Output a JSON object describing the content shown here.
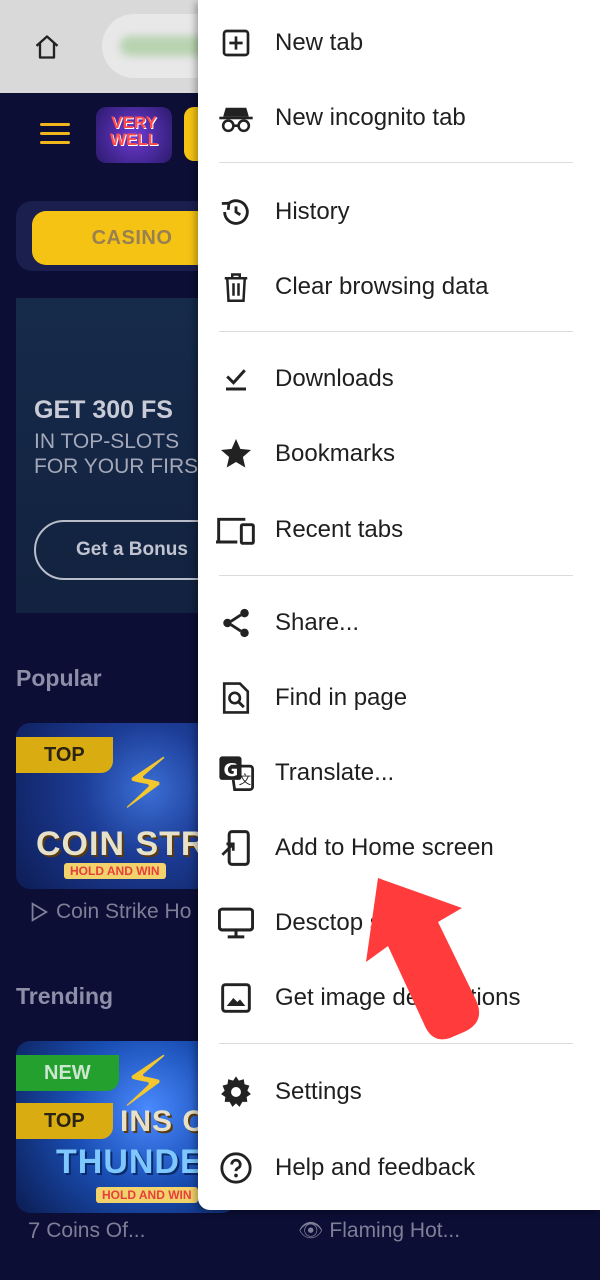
{
  "background_page": {
    "site": {
      "logo_line1": "VERY",
      "logo_line2": "WELL",
      "casino_tab": "CASINO",
      "banner": {
        "title": "GET 300 FS",
        "subtitle_line1": "IN TOP-SLOTS",
        "subtitle_line2": "FOR YOUR FIRS",
        "cta": "Get a Bonus"
      },
      "popular": {
        "title": "Popular",
        "card": {
          "tag": "TOP",
          "art_title": "COIN STRI",
          "art_sub": "HOLD AND WIN"
        },
        "game_name": "Coin Strike Ho"
      },
      "trending": {
        "title": "Trending",
        "card": {
          "tag_new": "NEW",
          "tag_top": "TOP",
          "art_title": "INS OF",
          "art_title2": "THUNDE",
          "art_sub": "HOLD AND WIN"
        },
        "game_names": [
          "Coins Of...",
          "Flaming Hot..."
        ]
      }
    }
  },
  "menu": {
    "items": [
      {
        "label": "New tab",
        "icon": "plus-box-icon"
      },
      {
        "label": "New incognito tab",
        "icon": "incognito-icon"
      },
      {
        "label": "History",
        "icon": "history-icon"
      },
      {
        "label": "Clear browsing data",
        "icon": "trash-icon"
      },
      {
        "label": "Downloads",
        "icon": "download-check-icon"
      },
      {
        "label": "Bookmarks",
        "icon": "star-icon"
      },
      {
        "label": "Recent tabs",
        "icon": "devices-icon"
      },
      {
        "label": "Share...",
        "icon": "share-icon"
      },
      {
        "label": "Find in page",
        "icon": "find-in-page-icon"
      },
      {
        "label": "Translate...",
        "icon": "translate-icon"
      },
      {
        "label": "Add to Home screen",
        "icon": "add-to-home-icon"
      },
      {
        "label": "Desctop site",
        "icon": "monitor-icon"
      },
      {
        "label": "Get image descriptions",
        "icon": "image-icon"
      },
      {
        "label": "Settings",
        "icon": "gear-icon"
      },
      {
        "label": "Help and feedback",
        "icon": "help-icon"
      }
    ]
  },
  "annotation": {
    "color": "#ff3b3b"
  }
}
